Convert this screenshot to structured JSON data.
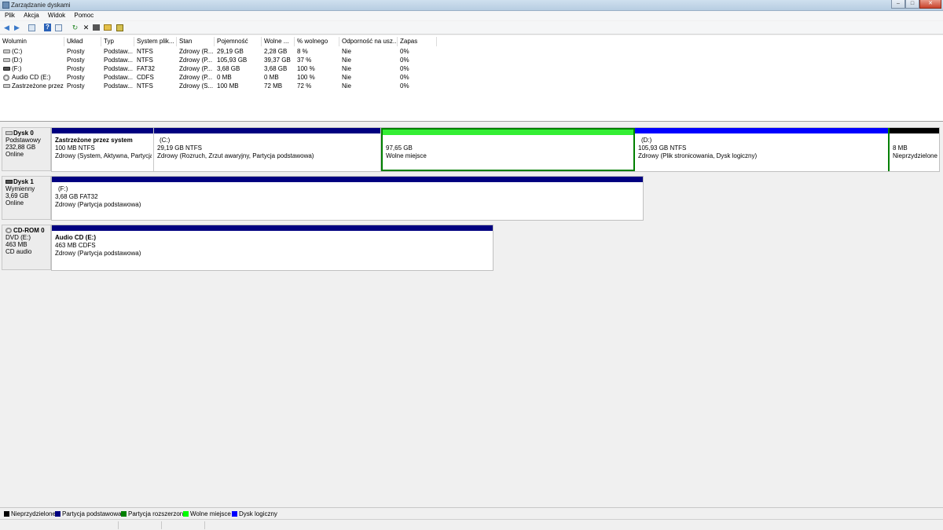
{
  "window": {
    "title": "Zarządzanie dyskami"
  },
  "menu": [
    "Plik",
    "Akcja",
    "Widok",
    "Pomoc"
  ],
  "toolbar_icons": [
    "back-arrow-icon",
    "forward-arrow-icon",
    "console-tree-icon",
    "help-icon",
    "properties-icon",
    "refresh-icon",
    "delete-icon",
    "open-icon",
    "explore-icon",
    "wizard-icon"
  ],
  "volume_columns": [
    "Wolumin",
    "Układ",
    "Typ",
    "System plik...",
    "Stan",
    "Pojemność",
    "Wolne ...",
    "% wolnego",
    "Odporność na usz...",
    "Zapas"
  ],
  "volumes": [
    [
      "(C:)",
      "Prosty",
      "Podstaw...",
      "NTFS",
      "Zdrowy (R...",
      "29,19 GB",
      "2,28 GB",
      "8 %",
      "Nie",
      "0%"
    ],
    [
      "(D:)",
      "Prosty",
      "Podstaw...",
      "NTFS",
      "Zdrowy (P...",
      "105,93 GB",
      "39,37 GB",
      "37 %",
      "Nie",
      "0%"
    ],
    [
      "(F:)",
      "Prosty",
      "Podstaw...",
      "FAT32",
      "Zdrowy (P...",
      "3,68 GB",
      "3,68 GB",
      "100 %",
      "Nie",
      "0%"
    ],
    [
      "Audio CD (E:)",
      "Prosty",
      "Podstaw...",
      "CDFS",
      "Zdrowy (P...",
      "0 MB",
      "0 MB",
      "100 %",
      "Nie",
      "0%"
    ],
    [
      "Zastrzeżone przez ...",
      "Prosty",
      "Podstaw...",
      "NTFS",
      "Zdrowy (S...",
      "100 MB",
      "72 MB",
      "72 %",
      "Nie",
      "0%"
    ]
  ],
  "disks": [
    {
      "name": "Dysk 0",
      "type": "Podstawowy",
      "size": "232,88 GB",
      "status": "Online",
      "partitions": [
        {
          "title": "Zastrzeżone przez system",
          "size": "100 MB NTFS",
          "status": "Zdrowy (System, Aktywna, Partycja p",
          "kind": "primary"
        },
        {
          "title": "(C:)",
          "size": "29,19 GB NTFS",
          "status": "Zdrowy (Rozruch, Zrzut awaryjny, Partycja podstawowa)",
          "kind": "primary"
        },
        {
          "title": "",
          "size": "97,65 GB",
          "status": "Wolne miejsce",
          "kind": "free"
        },
        {
          "title": "(D:)",
          "size": "105,93 GB NTFS",
          "status": "Zdrowy (Plik stronicowania, Dysk logiczny)",
          "kind": "logical"
        },
        {
          "title": "",
          "size": "8 MB",
          "status": "Nieprzydzielone",
          "kind": "unallocated"
        }
      ]
    },
    {
      "name": "Dysk 1",
      "type": "Wymienny",
      "size": "3,69 GB",
      "status": "Online",
      "partitions": [
        {
          "title": "(F:)",
          "size": "3,68 GB FAT32",
          "status": "Zdrowy (Partycja podstawowa)",
          "kind": "primary"
        }
      ]
    },
    {
      "name": "CD-ROM 0",
      "type": "DVD (E:)",
      "size": "463 MB",
      "status": "CD audio",
      "partitions": [
        {
          "title": "Audio CD  (E:)",
          "size": "463 MB CDFS",
          "status": "Zdrowy (Partycja podstawowa)",
          "kind": "primary"
        }
      ]
    }
  ],
  "legend": [
    {
      "label": "Nieprzydzielone",
      "color": "#000000"
    },
    {
      "label": "Partycja podstawowa",
      "color": "#000080"
    },
    {
      "label": "Partycja rozszerzona",
      "color": "#008000"
    },
    {
      "label": "Wolne miejsce",
      "color": "#00ff00"
    },
    {
      "label": "Dysk logiczny",
      "color": "#0000ff"
    }
  ],
  "colors": {
    "primary": "#000080",
    "logical": "#0000ff",
    "free": "#33ee33",
    "unallocated": "#000000",
    "extended": "#008000"
  }
}
